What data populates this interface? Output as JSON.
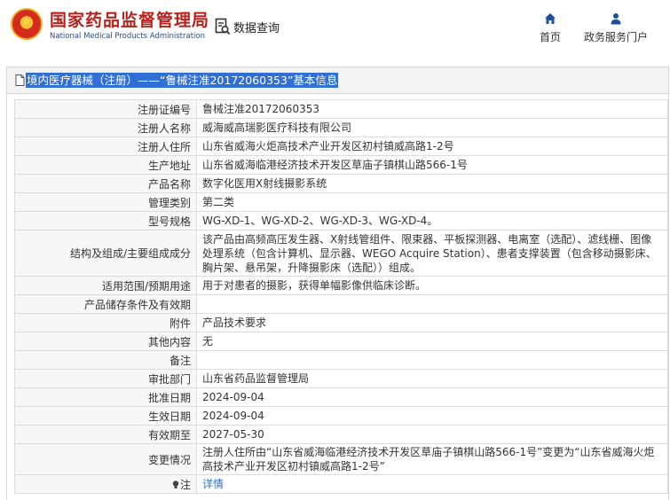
{
  "header": {
    "org_name_cn": "国家药品监督管理局",
    "org_name_en": "National Medical Products Administration",
    "search_label": "数据查询",
    "nav": [
      {
        "label": "首页",
        "icon": "home-icon"
      },
      {
        "label": "政务服务门户",
        "icon": "user-icon"
      }
    ]
  },
  "panel": {
    "title": "境内医疗器械（注册）——“鲁械注准20172060353”基本信息"
  },
  "details": [
    {
      "label": "注册证编号",
      "value": "鲁械注准20172060353"
    },
    {
      "label": "注册人名称",
      "value": "威海威高瑞影医疗科技有限公司"
    },
    {
      "label": "注册人住所",
      "value": "山东省威海火炬高技术产业开发区初村镇威高路1-2号"
    },
    {
      "label": "生产地址",
      "value": "山东省威海临港经济技术开发区草庙子镇棋山路566-1号"
    },
    {
      "label": "产品名称",
      "value": "数字化医用X射线摄影系统"
    },
    {
      "label": "管理类别",
      "value": "第二类"
    },
    {
      "label": "型号规格",
      "value": "WG-XD-1、WG-XD-2、WG-XD-3、WG-XD-4。"
    },
    {
      "label": "结构及组成/主要组成成分",
      "value": "该产品由高频高压发生器、X射线管组件、限束器、平板探测器、电离室（选配）、滤线栅、图像处理系统（包含计算机、显示器、WEGO Acquire Station）、患者支撑装置（包含移动摄影床、胸片架、悬吊架，升降摄影床（选配））组成。"
    },
    {
      "label": "适用范围/预期用途",
      "value": "用于对患者的摄影，获得单幅影像供临床诊断。"
    },
    {
      "label": "产品储存条件及有效期",
      "value": ""
    },
    {
      "label": "附件",
      "value": "产品技术要求"
    },
    {
      "label": "其他内容",
      "value": "无"
    },
    {
      "label": "备注",
      "value": ""
    },
    {
      "label": "审批部门",
      "value": "山东省药品监督管理局"
    },
    {
      "label": "批准日期",
      "value": "2024-09-04"
    },
    {
      "label": "生效日期",
      "value": "2024-09-04"
    },
    {
      "label": "有效期至",
      "value": "2027-05-30"
    },
    {
      "label": "变更情况",
      "value": "注册人住所由“山东省威海临港经济技术开发区草庙子镇棋山路566-1号”变更为“山东省威海火炬高技术产业开发区初村镇威高路1-2号”"
    }
  ],
  "note": {
    "label": "注",
    "link_text": "详情",
    "icon": "lightbulb-icon"
  },
  "colors": {
    "brand_red": "#b8211b",
    "link_blue": "#2f6fd6",
    "highlight_blue": "#2f6fd6"
  }
}
